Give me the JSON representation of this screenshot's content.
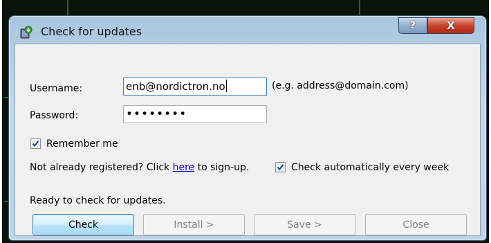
{
  "window": {
    "title": "Check for updates",
    "help_glyph": "?",
    "close_glyph": "X"
  },
  "form": {
    "username_label": "Username:",
    "username_value": "enb@nordictron.no",
    "username_hint": "(e.g. address@domain.com)",
    "password_label": "Password:",
    "password_mask": "••••••••",
    "remember_label": "Remember me",
    "remember_checked": true,
    "register_prefix": "Not already registered? Click ",
    "register_link": "here",
    "register_suffix": " to sign-up.",
    "auto_check_label": "Check automatically every week",
    "auto_check_checked": true
  },
  "status": {
    "text": "Ready to check for updates."
  },
  "buttons": {
    "check": "Check",
    "install": "Install >",
    "save": "Save >",
    "close": "Close"
  },
  "colors": {
    "link": "#0000cc",
    "close_button": "#c9432c",
    "frame": "#bdd3e8"
  }
}
